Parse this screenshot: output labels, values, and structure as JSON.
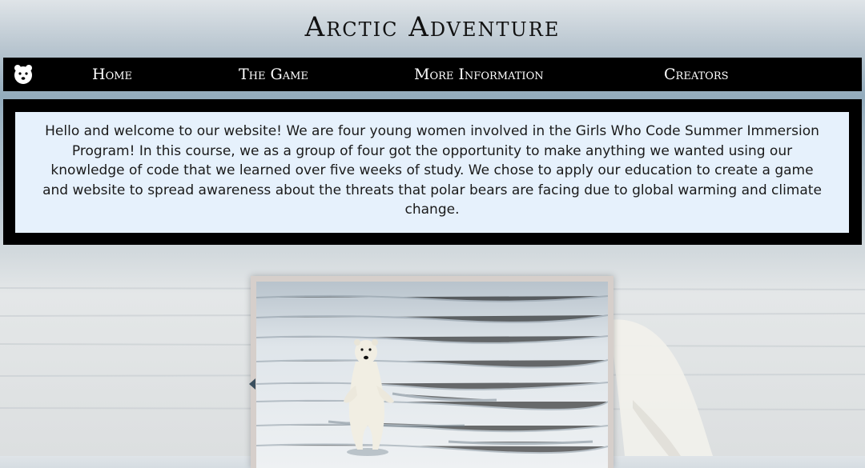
{
  "site": {
    "title": "Arctic Adventure"
  },
  "nav": {
    "logo_icon": "polar-bear-icon",
    "items": [
      {
        "label": "Home"
      },
      {
        "label": "The Game"
      },
      {
        "label": "More Information"
      },
      {
        "label": "Creators"
      }
    ]
  },
  "intro": {
    "text": "Hello and welcome to our website! We are four young women involved in the Girls Who Code Summer Immersion Program! In this course, we as a group of four got the opportunity to make anything we wanted using our knowledge of code that we learned over five weeks of study. We chose to apply our education to create a game and website to spread awareness about the threats that polar bears are facing due to global warming and climate change."
  },
  "gallery": {
    "prev_icon": "chevron-left-icon"
  },
  "colors": {
    "nav_bg": "#000000",
    "intro_bg": "#e6f1fc",
    "title_text": "#111111"
  }
}
